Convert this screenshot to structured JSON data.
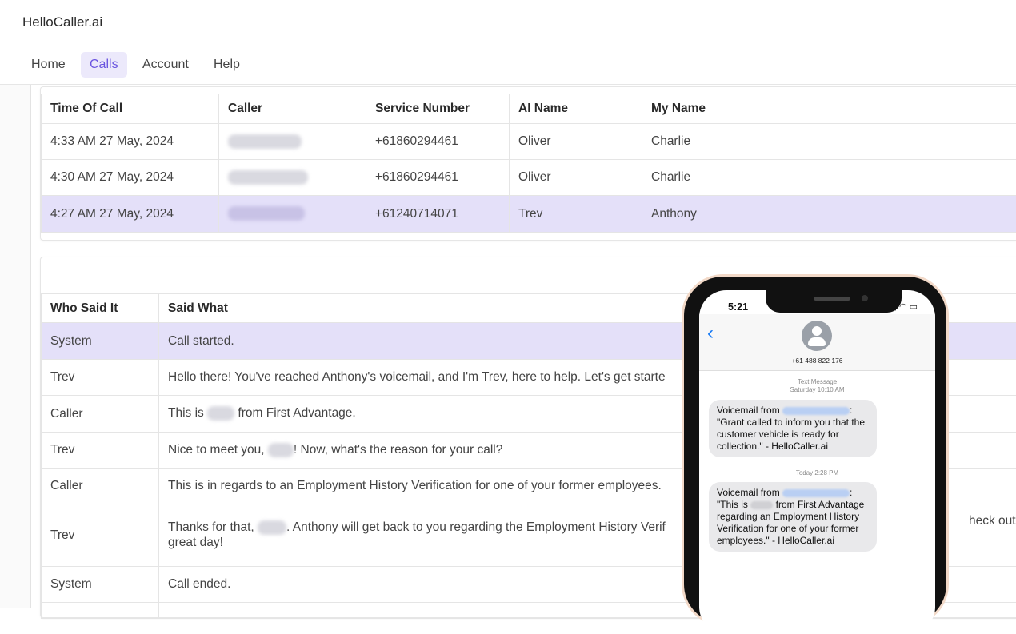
{
  "app": {
    "brand": "HelloCaller.ai"
  },
  "nav": {
    "items": [
      {
        "label": "Home"
      },
      {
        "label": "Calls"
      },
      {
        "label": "Account"
      },
      {
        "label": "Help"
      }
    ]
  },
  "calls_table": {
    "headers": [
      "Time Of Call",
      "Caller",
      "Service Number",
      "AI Name",
      "My Name"
    ],
    "rows": [
      {
        "time": "4:33 AM 27 May, 2024",
        "service": "+61860294461",
        "ai": "Oliver",
        "me": "Charlie"
      },
      {
        "time": "4:30 AM 27 May, 2024",
        "service": "+61860294461",
        "ai": "Oliver",
        "me": "Charlie"
      },
      {
        "time": "4:27 AM 27 May, 2024",
        "service": "+61240714071",
        "ai": "Trev",
        "me": "Anthony"
      }
    ]
  },
  "transcript": {
    "headers": [
      "Who Said It",
      "Said What"
    ],
    "rows": [
      {
        "who": "System",
        "what": "Call started."
      },
      {
        "who": "Trev",
        "what": "Hello there! You've reached Anthony's voicemail, and I'm Trev, here to help. Let's get starte"
      },
      {
        "who": "Caller",
        "what_a": "This is",
        "what_b": "from First Advantage."
      },
      {
        "who": "Trev",
        "what_a": "Nice to meet you,",
        "what_b": "! Now, what's the reason for your call?"
      },
      {
        "who": "Caller",
        "what": "This is in regards to an Employment History Verification for one of your former employees."
      },
      {
        "who": "Trev",
        "what_a": "Thanks for that,",
        "what_b": ". Anthony will get back to you regarding the Employment History Verif",
        "what_c": "heck out Hel",
        "what_d": "great day!"
      },
      {
        "who": "System",
        "what": "Call ended."
      }
    ]
  },
  "phone": {
    "time": "5:21",
    "contact_number": "+61 488 822 176",
    "stamp1_a": "Text Message",
    "stamp1_b": "Saturday 10:10 AM",
    "stamp2": "Today 2:28 PM",
    "msg1_prefix": "Voicemail from",
    "msg1_body": "\"Grant called to inform you that the customer vehicle is ready for collection.\" - HelloCaller.ai",
    "msg2_prefix": "Voicemail from",
    "msg2_a": "\"This is",
    "msg2_b": "from First Advantage regarding an Employment History Verification for one of your former employees.\" - HelloCaller.ai"
  }
}
